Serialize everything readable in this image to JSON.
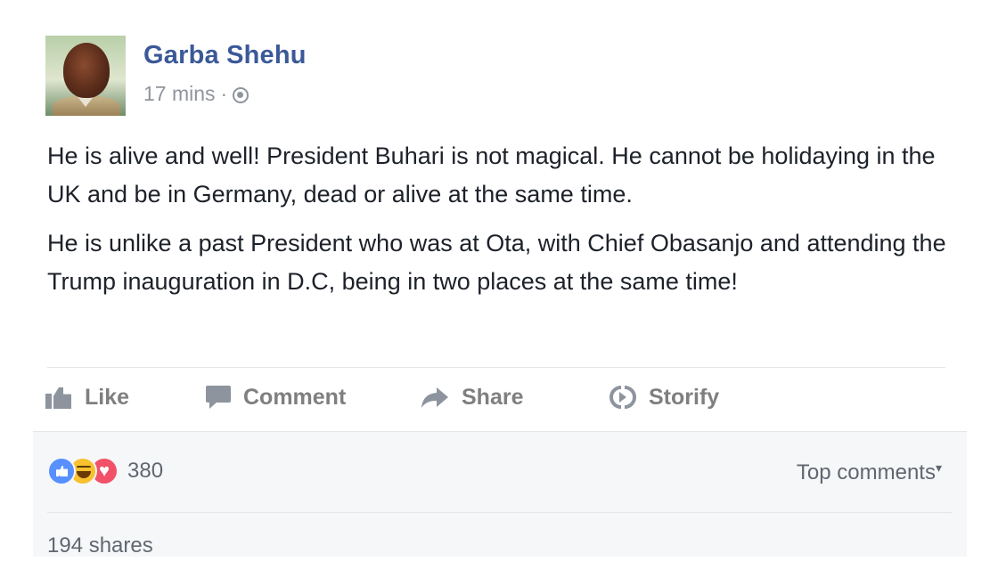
{
  "post": {
    "author": "Garba Shehu",
    "time": "17 mins",
    "separator": "·",
    "privacy_icon": "globe-icon",
    "paragraphs": [
      "He is alive and well! President Buhari is not magical. He cannot be holidaying in the UK and be in Germany, dead or alive at the same time.",
      "He is unlike a past President who was at Ota, with Chief Obasanjo and attending the Trump inauguration in D.C, being in two places at the same time!"
    ]
  },
  "actions": {
    "like": "Like",
    "comment": "Comment",
    "share": "Share",
    "storify": "Storify"
  },
  "footer": {
    "reaction_icons": [
      "like-reaction-icon",
      "haha-reaction-icon",
      "love-reaction-icon"
    ],
    "reaction_count": "380",
    "top_comments": "Top comments",
    "shares": "194 shares"
  },
  "colors": {
    "author_link": "#3b5998",
    "muted_text": "#90949c",
    "action_text": "#7f7f7f",
    "footer_bg": "#f6f7f9",
    "like_reaction": "#5890ff",
    "haha_reaction": "#f7c12f",
    "love_reaction": "#f25268"
  }
}
